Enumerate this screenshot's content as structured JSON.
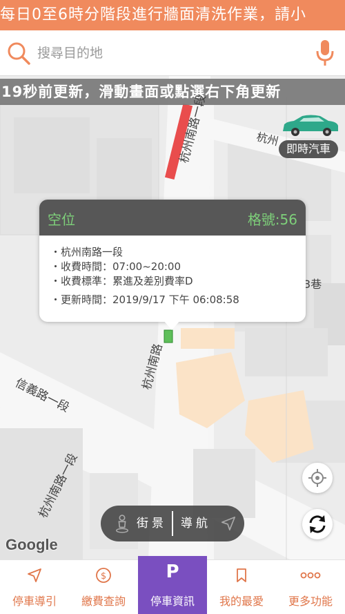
{
  "banner": {
    "text": "每日0至6時分階段進行牆面清洗作業，請小"
  },
  "search": {
    "placeholder": "搜尋目的地"
  },
  "update_notice": "19秒前更新，滑動畫面或點選右下角更新",
  "map": {
    "street_labels": {
      "hangzhou_s_rd_top": "杭州南路一段",
      "hangzhou_s_rd_mid": "杭州南路",
      "xinyi_rd": "信義路一段",
      "hangzhou_s_rd_bottom": "杭州南路一段",
      "lane_right": "3巷",
      "road_top_right": "杭州"
    },
    "google_logo": "Google"
  },
  "car_chip": {
    "label": "即時汽車"
  },
  "popup": {
    "status": "空位",
    "slot_label": "格號:56",
    "lines": [
      "・杭州南路一段",
      "・收費時間：07:00~20:00",
      "・收費標準：累進及差別費率D"
    ],
    "updated": "・更新時間：2019/9/17 下午 06:08:58"
  },
  "mode": {
    "streetview_label": "街景",
    "navigate_label": "導航"
  },
  "tabs": [
    {
      "label": "停車導引",
      "icon": "navigation-arrow-icon",
      "active": false
    },
    {
      "label": "繳費查詢",
      "icon": "dollar-coin-icon",
      "active": false
    },
    {
      "label": "停車資訊",
      "icon": "parking-p-icon",
      "active": true,
      "glyph": "P"
    },
    {
      "label": "我的最愛",
      "icon": "bookmark-icon",
      "active": false
    },
    {
      "label": "更多功能",
      "icon": "more-dots-icon",
      "active": false
    }
  ],
  "colors": {
    "accent": "#f08a5d",
    "tab_active": "#7a4fc0",
    "popup_head": "#575757",
    "status_green": "#7ed07a"
  }
}
